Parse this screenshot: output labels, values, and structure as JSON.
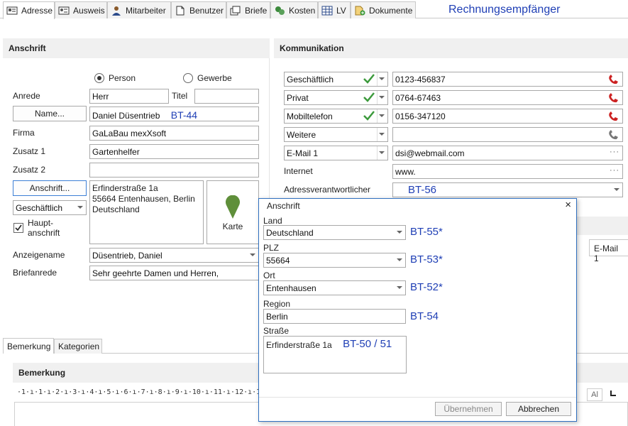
{
  "tabs": [
    {
      "label": "Adresse"
    },
    {
      "label": "Ausweis"
    },
    {
      "label": "Mitarbeiter"
    },
    {
      "label": "Benutzer"
    },
    {
      "label": "Briefe"
    },
    {
      "label": "Kosten"
    },
    {
      "label": "LV"
    },
    {
      "label": "Dokumente"
    }
  ],
  "header_annotation": "Rechnungsempfänger",
  "anschrift": {
    "title": "Anschrift",
    "radio_person": "Person",
    "radio_gewerbe": "Gewerbe",
    "anrede_label": "Anrede",
    "anrede_value": "Herr",
    "titel_label": "Titel",
    "titel_value": "",
    "name_button": "Name...",
    "name_value": "Daniel Düsentrieb",
    "name_annotation": "BT-44",
    "firma_label": "Firma",
    "firma_value": "GaLaBau mexXsoft",
    "zusatz1_label": "Zusatz 1",
    "zusatz1_value": "Gartenhelfer",
    "zusatz2_label": "Zusatz 2",
    "zusatz2_value": "",
    "anschrift_button": "Anschrift...",
    "address_lines": [
      "Erfinderstraße 1a",
      "55664 Entenhausen, Berlin",
      "Deutschland"
    ],
    "address_type": "Geschäftlich",
    "haupt_label_1": "Haupt-",
    "haupt_label_2": "anschrift",
    "karte_label": "Karte",
    "anzeigename_label": "Anzeigename",
    "anzeigename_value": "Düsentrieb, Daniel",
    "briefanrede_label": "Briefanrede",
    "briefanrede_value": "Sehr geehrte Damen und Herren,"
  },
  "kommunikation": {
    "title": "Kommunikation",
    "rows": [
      {
        "type": "Geschäftlich",
        "value": "0123-456837"
      },
      {
        "type": "Privat",
        "value": "0764-67463"
      },
      {
        "type": "Mobiltelefon",
        "value": "0156-347120"
      },
      {
        "type": "Weitere",
        "value": ""
      },
      {
        "type": "E-Mail 1",
        "value": "dsi@webmail.com"
      }
    ],
    "internet_label": "Internet",
    "internet_value": "www.",
    "adressverantwortlicher_label": "Adressverantwortlicher",
    "adressverantwortlicher_annotation": "BT-56",
    "email_column": "E-Mail 1"
  },
  "bottom_tabs": [
    {
      "label": "Bemerkung"
    },
    {
      "label": "Kategorien"
    }
  ],
  "bemerkung_title": "Bemerkung",
  "ruler_text": "·1·ı·1·ı·2·ı·3·ı·4·ı·5·ı·6·ı·7·ı·8·ı·9·ı·10·ı·11·ı·12·ı·13·ı·14·ı·",
  "dialog": {
    "title": "Anschrift",
    "close": "×",
    "land_label": "Land",
    "land_value": "Deutschland",
    "land_annotation": "BT-55*",
    "plz_label": "PLZ",
    "plz_value": "55664",
    "plz_annotation": "BT-53*",
    "ort_label": "Ort",
    "ort_value": "Entenhausen",
    "ort_annotation": "BT-52*",
    "region_label": "Region",
    "region_value": "Berlin",
    "region_annotation": "BT-54",
    "strasse_label": "Straße",
    "strasse_value": "Erfinderstraße 1a",
    "strasse_annotation": "BT-50 / 51",
    "uebernehmen": "Übernehmen",
    "abbrechen": "Abbrechen"
  },
  "colors": {
    "accent": "#1f3fb5",
    "check": "#3c9a3c",
    "phone_red": "#cc2222",
    "phone_grey": "#777777",
    "dialog_border": "#2f6fbf"
  }
}
